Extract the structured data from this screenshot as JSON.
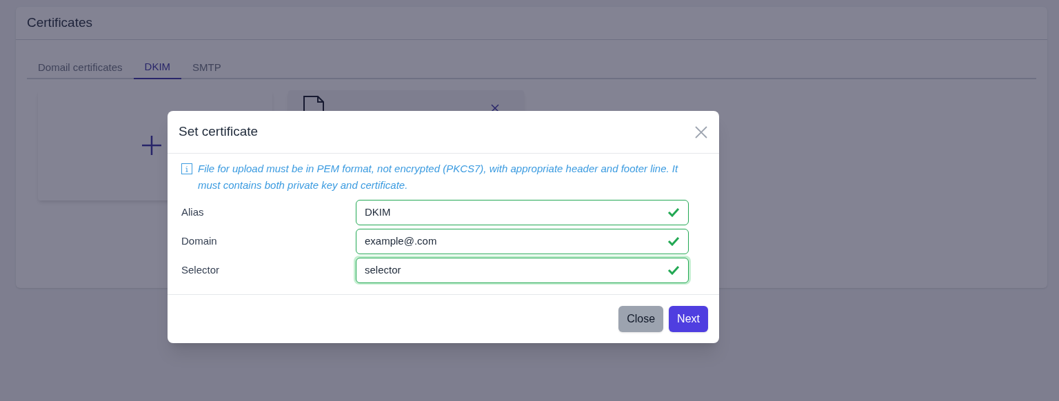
{
  "page": {
    "title": "Certificates"
  },
  "tabs": [
    {
      "label": "Domail certificates",
      "selected": false
    },
    {
      "label": "DKIM",
      "selected": true
    },
    {
      "label": "SMTP",
      "selected": false
    }
  ],
  "dialog": {
    "title": "Set certificate",
    "info": "File for upload must be in PEM format, not encrypted (PKCS7), with appropriate header and footer line. It must contains both private key and certificate.",
    "fields": [
      {
        "label": "Alias",
        "value": "DKIM",
        "valid": true,
        "focused": false
      },
      {
        "label": "Domain",
        "value": "example@.com",
        "valid": true,
        "focused": false
      },
      {
        "label": "Selector",
        "value": "selector",
        "valid": true,
        "focused": true
      }
    ],
    "buttons": [
      {
        "label": "Close",
        "kind": "secondary"
      },
      {
        "label": "Next",
        "kind": "primary"
      }
    ]
  }
}
